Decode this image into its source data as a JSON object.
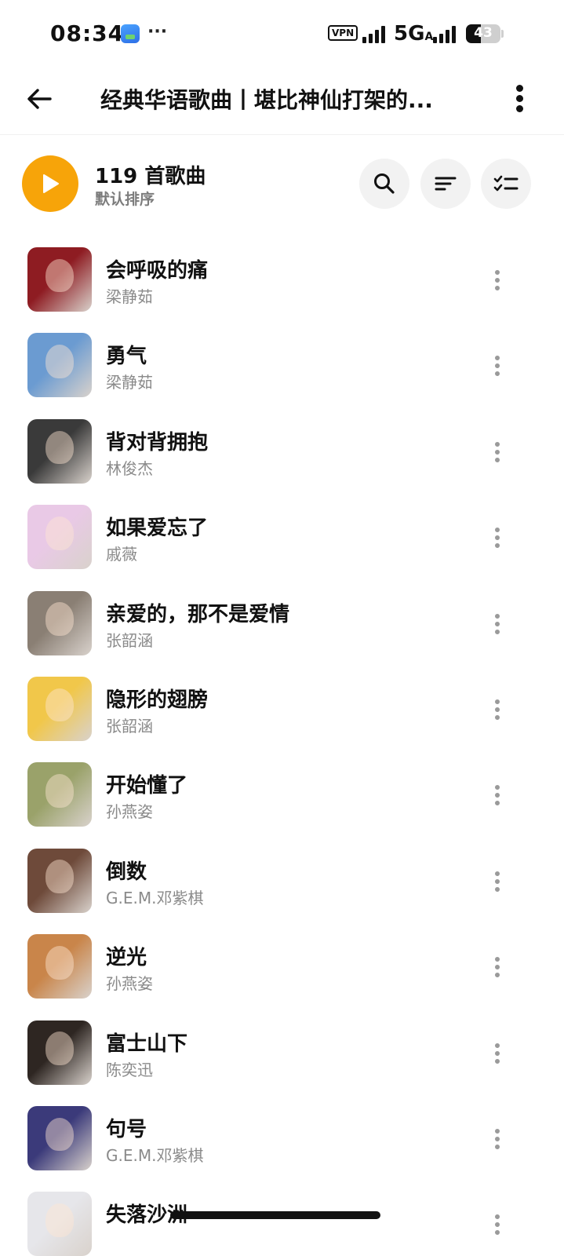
{
  "status_bar": {
    "time": "08:34",
    "notification_dots": "···",
    "vpn_label": "VPN",
    "network": "5G",
    "network_sub": "A",
    "battery": "43",
    "battery_level_percent": 43
  },
  "header": {
    "title": "经典华语歌曲丨堪比神仙打架的..."
  },
  "toolbar": {
    "song_count": "119 首歌曲",
    "sort_label": "默认排序",
    "accent_color": "#f7a409"
  },
  "songs": [
    {
      "title": "会呼吸的痛",
      "artist": "梁静茹",
      "cover_color": "#8e1c22"
    },
    {
      "title": "勇气",
      "artist": "梁静茹",
      "cover_color": "#6b9bd1"
    },
    {
      "title": "背对背拥抱",
      "artist": "林俊杰",
      "cover_color": "#3a3a3a"
    },
    {
      "title": "如果爱忘了",
      "artist": "戚薇",
      "cover_color": "#e9c9e6"
    },
    {
      "title": "亲爱的，那不是爱情",
      "artist": "张韶涵",
      "cover_color": "#8a7f74"
    },
    {
      "title": "隐形的翅膀",
      "artist": "张韶涵",
      "cover_color": "#f1c74a"
    },
    {
      "title": "开始懂了",
      "artist": "孙燕姿",
      "cover_color": "#9aa26a"
    },
    {
      "title": "倒数",
      "artist": "G.E.M.邓紫棋",
      "cover_color": "#6e4a3a"
    },
    {
      "title": "逆光",
      "artist": "孙燕姿",
      "cover_color": "#c9854a"
    },
    {
      "title": "富士山下",
      "artist": "陈奕迅",
      "cover_color": "#2e2622"
    },
    {
      "title": "句号",
      "artist": "G.E.M.邓紫棋",
      "cover_color": "#3b3a7a"
    },
    {
      "title": "失落沙洲",
      "artist": "",
      "cover_color": "#e6e6ea"
    }
  ]
}
